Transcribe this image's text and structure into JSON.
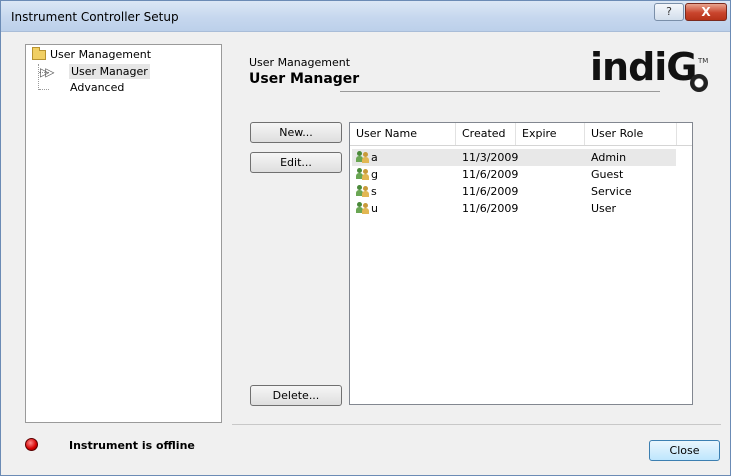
{
  "window": {
    "title": "Instrument Controller Setup",
    "help_glyph": "?",
    "close_glyph": "X"
  },
  "tree": {
    "root_label": "User Management",
    "items": [
      {
        "label": "User Manager",
        "selected": true
      },
      {
        "label": "Advanced",
        "selected": false
      }
    ]
  },
  "header": {
    "section": "User Management",
    "title": "User Manager"
  },
  "logo": {
    "text": "indiG",
    "tm": "TM"
  },
  "buttons": {
    "new": "New...",
    "edit": "Edit...",
    "delete": "Delete...",
    "close": "Close"
  },
  "users_table": {
    "columns": [
      "User Name",
      "Created",
      "Expire",
      "User Role"
    ],
    "rows": [
      {
        "name": "a",
        "created": "11/3/2009",
        "expire": "",
        "role": "Admin",
        "selected": true
      },
      {
        "name": "g",
        "created": "11/6/2009",
        "expire": "",
        "role": "Guest",
        "selected": false
      },
      {
        "name": "s",
        "created": "11/6/2009",
        "expire": "",
        "role": "Service",
        "selected": false
      },
      {
        "name": "u",
        "created": "11/6/2009",
        "expire": "",
        "role": "User",
        "selected": false
      }
    ]
  },
  "status": {
    "text": "Instrument is offline",
    "led_color": "#d40000"
  }
}
